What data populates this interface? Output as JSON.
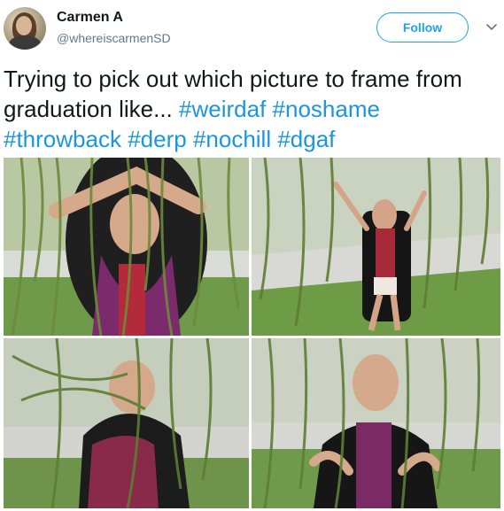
{
  "user": {
    "name": "Carmen A",
    "handle": "@whereiscarmenSD"
  },
  "actions": {
    "follow_label": "Follow"
  },
  "tweet": {
    "text_plain": "Trying to pick out which picture to frame from graduation like... ",
    "hashtags": [
      "#weirdaf",
      "#noshame",
      "#throwback",
      "#derp",
      "#nochill",
      "#dgaf"
    ]
  },
  "colors": {
    "accent": "#1da1f2",
    "hashtag": "#1b95e0"
  },
  "icons": {
    "menu": "chevron-down-icon"
  }
}
